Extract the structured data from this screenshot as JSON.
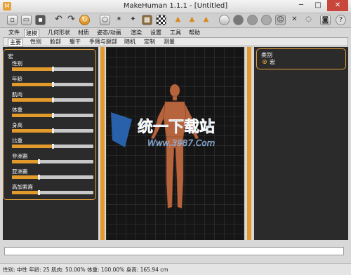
{
  "window": {
    "title": "MakeHuman 1.1.1 - [Untitled]",
    "minimize": "─",
    "maximize": "□",
    "close": "✕"
  },
  "toolbar": {
    "icons": [
      "new-file-icon",
      "save-icon",
      "export-icon",
      "undo-icon",
      "redo-icon",
      "reset-icon",
      "wireframe-icon",
      "pose-icon",
      "smooth-icon",
      "grid-icon",
      "checker-icon",
      "front-view-icon",
      "back-view-icon",
      "side-view-icon",
      "sphere-icon",
      "skin-icon",
      "hair-icon",
      "cloth-icon",
      "face-icon",
      "zoom-icon",
      "camera-icon",
      "help-icon"
    ]
  },
  "menu": {
    "tabs": [
      "文件",
      "建模",
      "几何形状",
      "材质",
      "姿态/动画",
      "渲染",
      "设置",
      "工具",
      "帮助"
    ],
    "active": "建模"
  },
  "subtabs": {
    "items": [
      "主要",
      "性别",
      "脸部",
      "躯干",
      "手臂与腿部",
      "随机",
      "定制",
      "测量"
    ],
    "active": "主要"
  },
  "macro": {
    "title": "宏",
    "sliders": [
      {
        "label": "性别",
        "value": 0.5
      },
      {
        "label": "年龄",
        "value": 0.5
      },
      {
        "label": "肌肉",
        "value": 0.5
      },
      {
        "label": "体重",
        "value": 0.5
      },
      {
        "label": "身高",
        "value": 0.5
      },
      {
        "label": "比重",
        "value": 0.5
      },
      {
        "label": "非洲裔",
        "value": 0.33
      },
      {
        "label": "亚洲裔",
        "value": 0.33
      },
      {
        "label": "高加索裔",
        "value": 0.33
      }
    ]
  },
  "category": {
    "title": "类别",
    "option": "宏"
  },
  "watermark": {
    "main": "统一下载站",
    "url": "Www.3987.Com"
  },
  "status": "性别: 中性 年龄: 25 肌肉: 50.00% 体重: 100.00% 身高: 165.94 cm",
  "colors": {
    "accent": "#e39a2c",
    "panel": "#2b2b2b",
    "viewport": "#151515",
    "skin": "#b5643e"
  }
}
